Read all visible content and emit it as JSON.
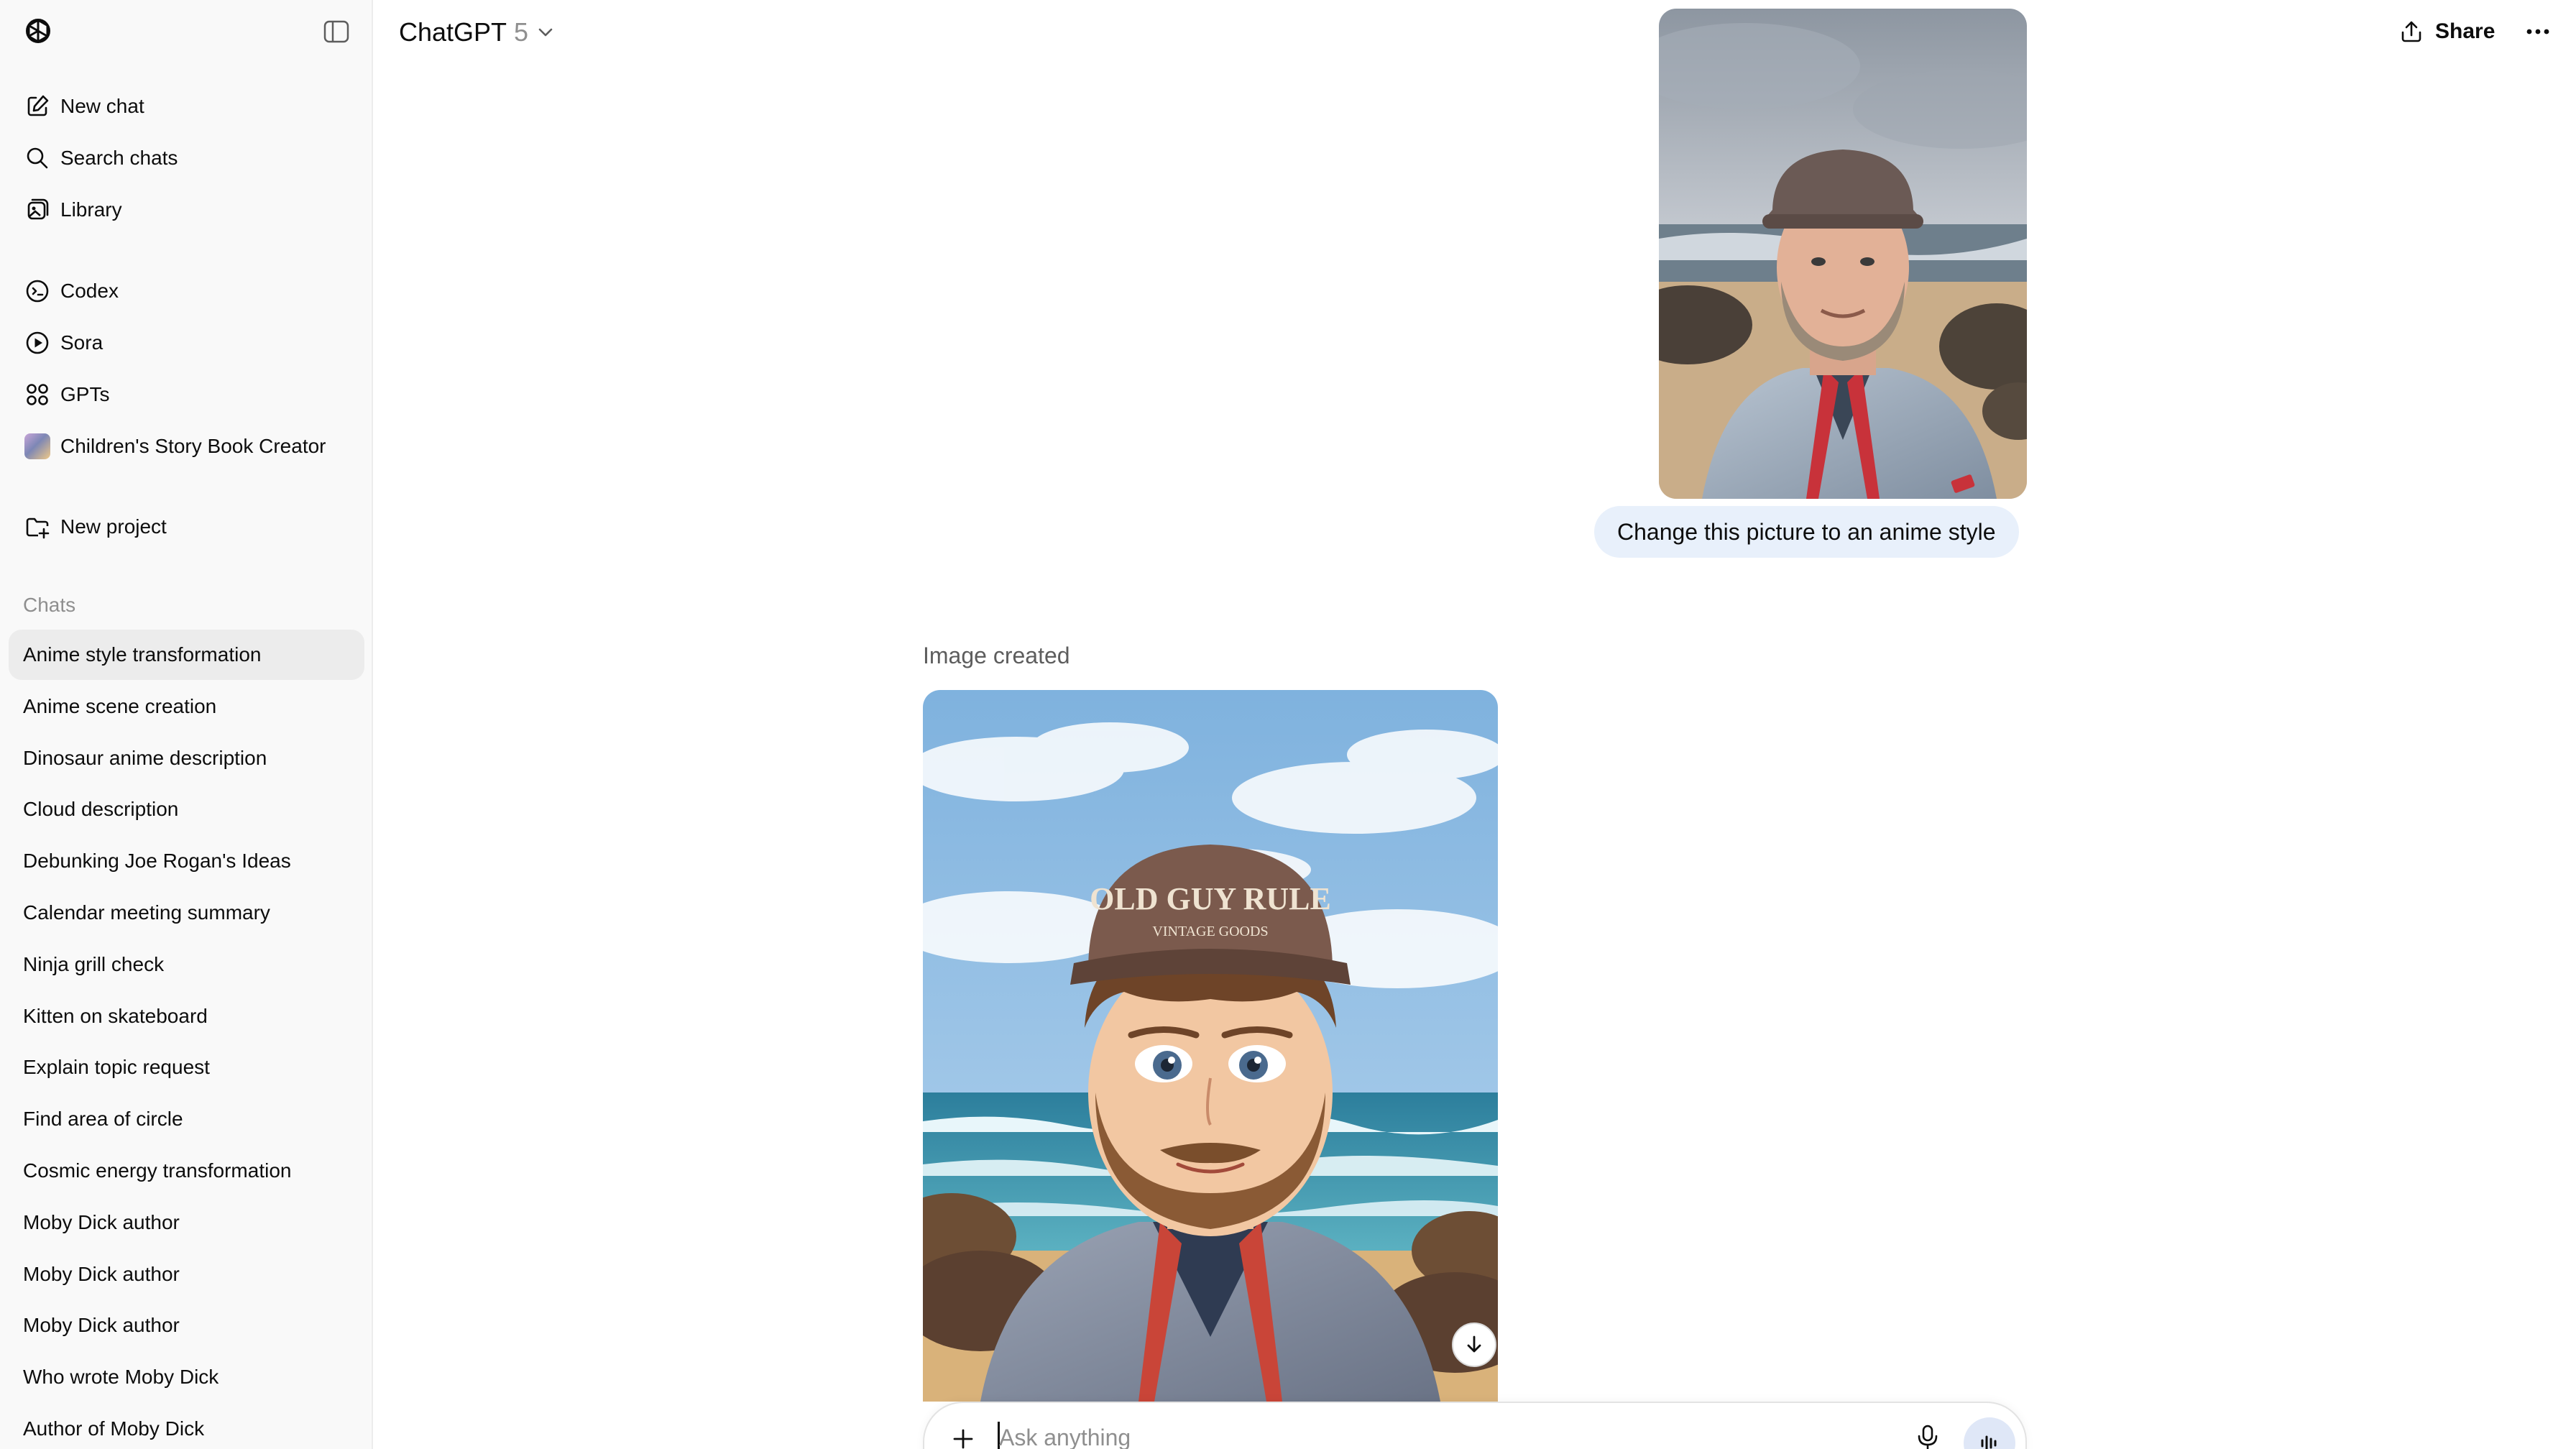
{
  "header": {
    "model_name": "ChatGPT",
    "model_version": "5",
    "share_label": "Share"
  },
  "sidebar": {
    "top_items": [
      {
        "label": "New chat",
        "icon": "edit-icon"
      },
      {
        "label": "Search chats",
        "icon": "search-icon"
      },
      {
        "label": "Library",
        "icon": "library-icon"
      }
    ],
    "app_items": [
      {
        "label": "Codex",
        "icon": "codex-icon"
      },
      {
        "label": "Sora",
        "icon": "sora-icon"
      },
      {
        "label": "GPTs",
        "icon": "gpts-icon"
      },
      {
        "label": "Children's Story Book Creator",
        "icon": "gpt-avatar"
      }
    ],
    "project_item": {
      "label": "New project",
      "icon": "folder-plus-icon"
    },
    "chats_label": "Chats",
    "chats": [
      "Anime style transformation",
      "Anime scene creation",
      "Dinosaur anime description",
      "Cloud description",
      "Debunking Joe Rogan's Ideas",
      "Calendar meeting summary",
      "Ninja grill check",
      "Kitten on skateboard",
      "Explain topic request",
      "Find area of circle",
      "Cosmic energy transformation",
      "Moby Dick author",
      "Moby Dick author",
      "Moby Dick author",
      "Who wrote Moby Dick",
      "Author of Moby Dick"
    ],
    "active_chat_index": 0
  },
  "conversation": {
    "user_message": "Change this picture to an anime style",
    "assistant_status": "Image created",
    "generated_image_text": {
      "cap_line1": "OLD GUY RULE",
      "cap_line2": "VINTAGE GOODS"
    }
  },
  "composer": {
    "placeholder": "Ask anything",
    "value": ""
  },
  "colors": {
    "sidebar_bg": "#f9f9f9",
    "active_chat_bg": "#ececec",
    "user_bubble_bg": "#e8f0fb",
    "voice_button_bg": "#dfe7f7"
  }
}
